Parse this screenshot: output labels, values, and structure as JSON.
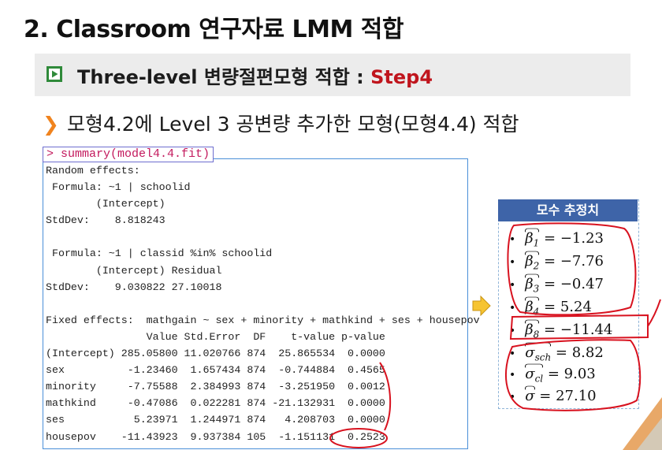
{
  "slide": {
    "title": "2. Classroom 연구자료 LMM 적합",
    "subtitle_main": "Three-level 변량절편모형 적합 : ",
    "subtitle_step": "Step4",
    "bullet": "모형4.2에 Level 3 공변량 추가한 모형(모형4.4) 적합"
  },
  "console": {
    "command": "> summary(model4.4.fit)",
    "lines": [
      "Random effects:",
      " Formula: ~1 | schoolid",
      "        (Intercept)",
      "StdDev:    8.818243",
      "",
      " Formula: ~1 | classid %in% schoolid",
      "        (Intercept) Residual",
      "StdDev:    9.030822 27.10018",
      "",
      "Fixed effects:  mathgain ~ sex + minority + mathkind + ses + housepov",
      "                Value Std.Error  DF    t-value p-value",
      "(Intercept) 285.05800 11.020766 874  25.865534  0.0000",
      "sex          -1.23460  1.657434 874  -0.744884  0.4565",
      "minority     -7.75588  2.384993 874  -3.251950  0.0012",
      "mathkind     -0.47086  0.022281 874 -21.132931  0.0000",
      "ses           5.23971  1.244971 874   4.208703  0.0000",
      "housepov    -11.43923  9.937384 105  -1.151131  0.2523"
    ]
  },
  "estimates": {
    "header": "모수 추정치",
    "bullet_char": "•",
    "items": [
      {
        "symbol": "β",
        "sub": "1",
        "value": "= −1.23"
      },
      {
        "symbol": "β",
        "sub": "2",
        "value": "= −7.76"
      },
      {
        "symbol": "β",
        "sub": "3",
        "value": "= −0.47"
      },
      {
        "symbol": "β",
        "sub": "4",
        "value": "= 5.24"
      },
      {
        "symbol": "β",
        "sub": "8",
        "value": "= −11.44"
      },
      {
        "symbol": "σ",
        "sub": "sch",
        "value": "= 8.82"
      },
      {
        "symbol": "σ",
        "sub": "cl",
        "value": "= 9.03"
      },
      {
        "symbol": "σ",
        "sub": "",
        "value": "= 27.10"
      }
    ]
  },
  "colors": {
    "accent_red": "#c0151d",
    "header_blue": "#3e64a8",
    "frame_blue": "#4a8fd8",
    "command_pink": "#c3195d",
    "chevron_orange": "#f0831e",
    "icon_green": "#2f8a3a"
  }
}
